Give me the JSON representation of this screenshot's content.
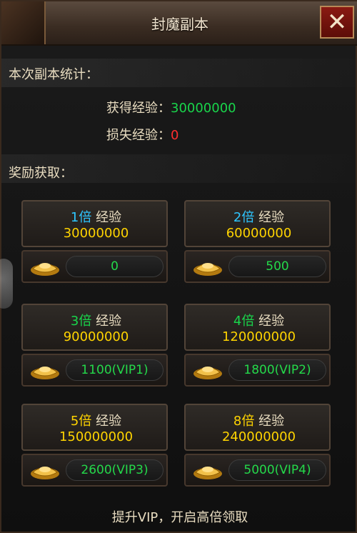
{
  "window": {
    "title": "封魔副本",
    "close_icon": "✕"
  },
  "stats": {
    "label": "本次副本统计：",
    "gain_label": "获得经验：",
    "gain_value": "30000000",
    "loss_label": "损失经验：",
    "loss_value": "0"
  },
  "rewards": {
    "label": "奖励获取：",
    "items": [
      {
        "mult": "1倍",
        "word": "经验",
        "exp": "30000000",
        "cost": "0",
        "mult_color": "#2ec6ff"
      },
      {
        "mult": "2倍",
        "word": "经验",
        "exp": "60000000",
        "cost": "500",
        "mult_color": "#2ec6ff"
      },
      {
        "mult": "3倍",
        "word": "经验",
        "exp": "90000000",
        "cost": "1100(VIP1)",
        "mult_color": "#19d54b"
      },
      {
        "mult": "4倍",
        "word": "经验",
        "exp": "120000000",
        "cost": "1800(VIP2)",
        "mult_color": "#19d54b"
      },
      {
        "mult": "5倍",
        "word": "经验",
        "exp": "150000000",
        "cost": "2600(VIP3)",
        "mult_color": "#ffd400"
      },
      {
        "mult": "8倍",
        "word": "经验",
        "exp": "240000000",
        "cost": "5000(VIP4)",
        "mult_color": "#ffd400"
      }
    ]
  },
  "footer": {
    "text": "提升VIP，开启高倍领取"
  }
}
